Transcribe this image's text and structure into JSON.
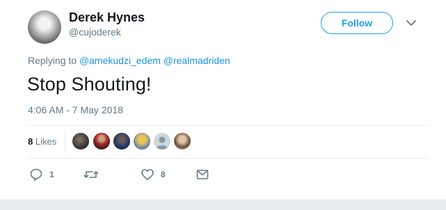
{
  "user": {
    "name": "Derek Hynes",
    "handle": "@cujoderek"
  },
  "follow_label": "Follow",
  "reply": {
    "prefix": "Replying to",
    "mentions": [
      "@amekudzi_edem",
      "@realmadriden"
    ]
  },
  "tweet_text": "Stop Shouting!",
  "timestamp": "4:06 AM - 7 May 2018",
  "likes": {
    "count": "8",
    "label": "Likes"
  },
  "actions": {
    "replies": "1",
    "retweets": "",
    "likes": "8"
  },
  "colors": {
    "accent": "#1da1f2",
    "muted": "#657786",
    "divider": "#e6ecf0"
  }
}
